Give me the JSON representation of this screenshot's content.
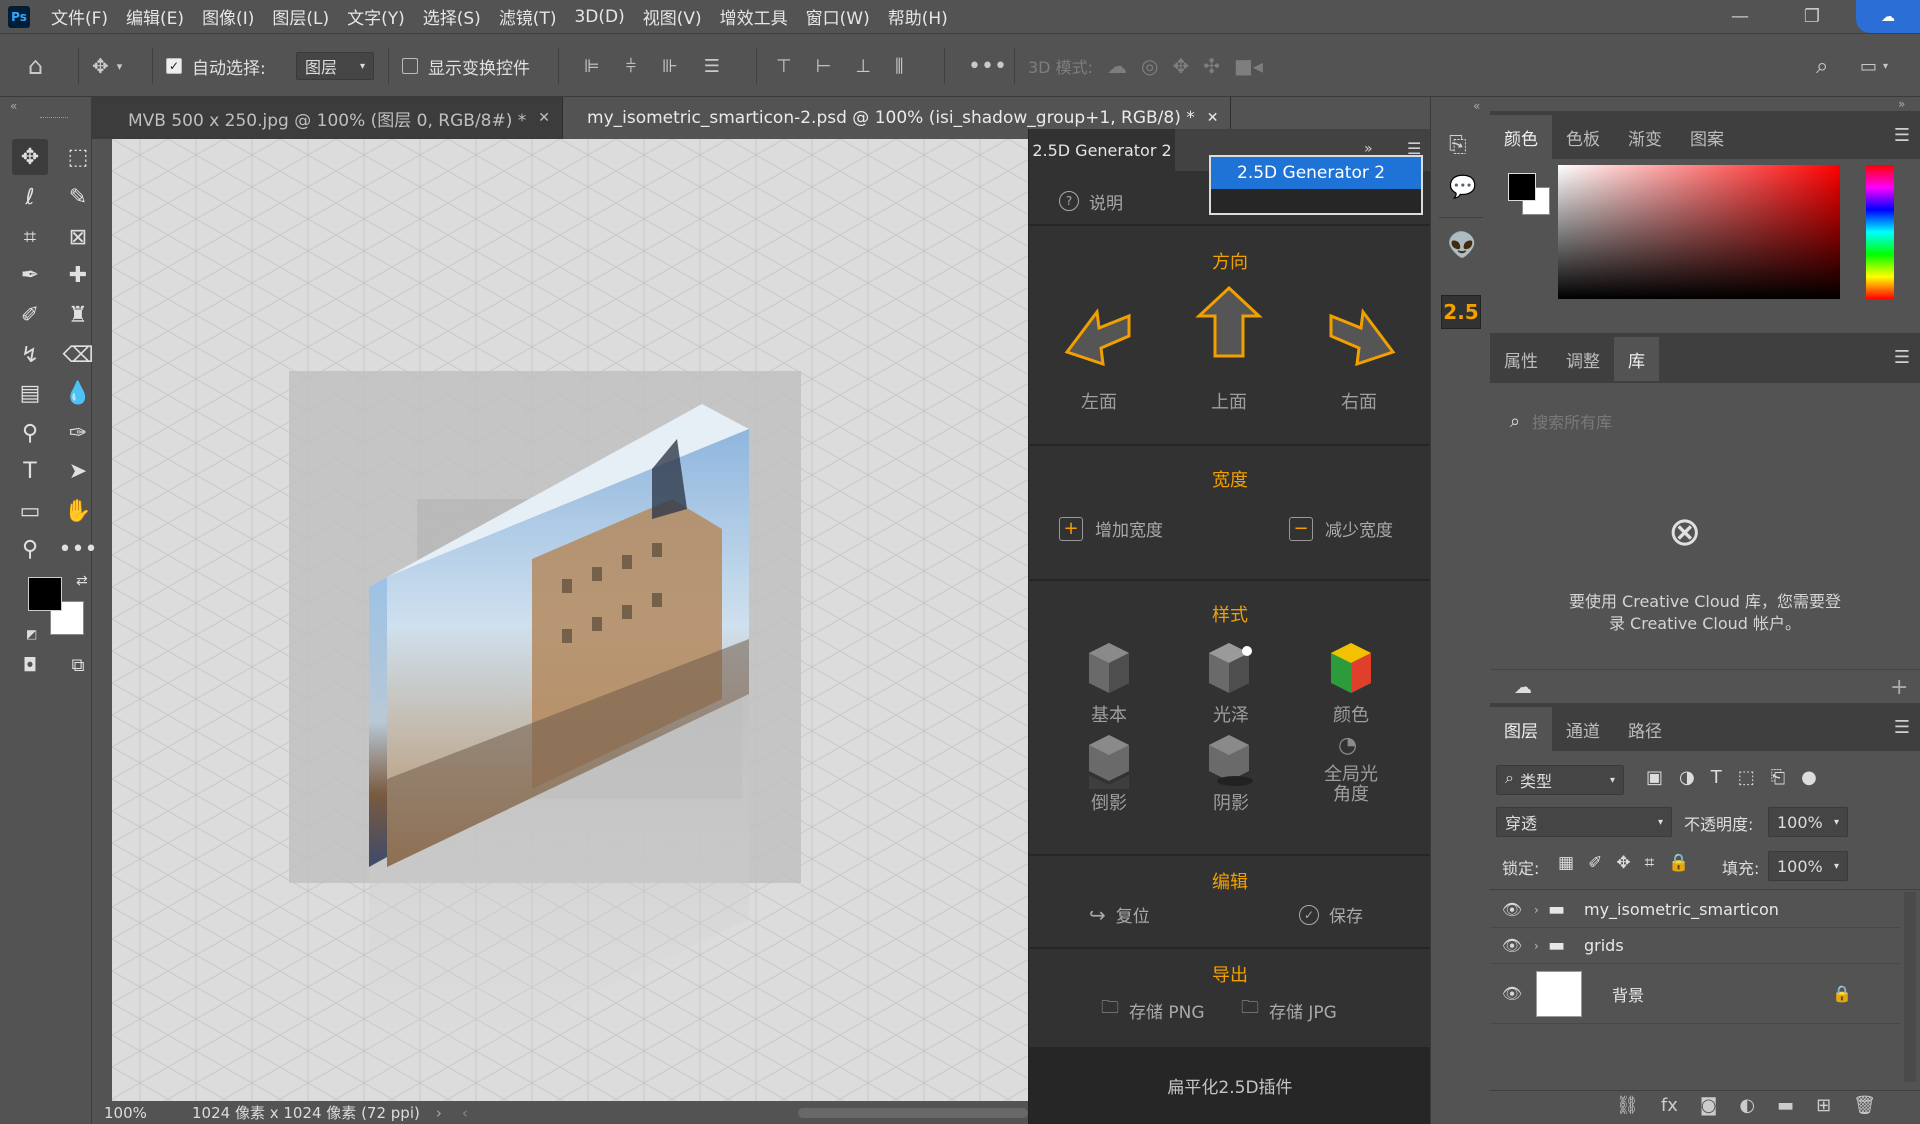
{
  "app": {
    "logo": "Ps"
  },
  "menu": [
    "文件(F)",
    "编辑(E)",
    "图像(I)",
    "图层(L)",
    "文字(Y)",
    "选择(S)",
    "滤镜(T)",
    "3D(D)",
    "视图(V)",
    "增效工具",
    "窗口(W)",
    "帮助(H)"
  ],
  "options": {
    "auto_select_label": "自动选择:",
    "auto_select_value": "图层",
    "show_transform_label": "显示变换控件",
    "mode_3d_label": "3D 模式:"
  },
  "tabs": [
    {
      "label": "MVB 500 x 250.jpg @ 100% (图层 0, RGB/8#) *"
    },
    {
      "label": "my_isometric_smarticon-2.psd @ 100% (isi_shadow_group+1, RGB/8) *"
    }
  ],
  "status": {
    "zoom": "100%",
    "doc_info": "1024 像素 x 1024 像素 (72 ppi)"
  },
  "plugin": {
    "tab_title": "2.5D Generator 2",
    "dropdown_item": "2.5D Generator 2",
    "help_label": "说明",
    "direction": {
      "title": "方向",
      "left": "左面",
      "up": "上面",
      "right": "右面"
    },
    "width": {
      "title": "宽度",
      "add": "增加宽度",
      "reduce": "减少宽度"
    },
    "style": {
      "title": "样式",
      "basic": "基本",
      "gloss": "光泽",
      "color": "颜色",
      "reflection": "倒影",
      "shadow": "阴影",
      "global_light_line1": "全局光",
      "global_light_line2": "角度"
    },
    "edit": {
      "title": "编辑",
      "reset": "复位",
      "save": "保存"
    },
    "export": {
      "title": "导出",
      "png": "存储 PNG",
      "jpg": "存储 JPG"
    },
    "footer": "扁平化2.5D插件"
  },
  "iconstrip": {
    "badge": "2.5"
  },
  "color_panel": {
    "tabs": [
      "颜色",
      "色板",
      "渐变",
      "图案"
    ],
    "foreground": "#000000",
    "background": "#ffffff"
  },
  "library_panel": {
    "tabs": [
      "属性",
      "调整",
      "库"
    ],
    "search_placeholder": "搜索所有库",
    "message_line1": "要使用 Creative Cloud 库，您需要登",
    "message_line2": "录 Creative Cloud 帐户。"
  },
  "layers_panel": {
    "tabs": [
      "图层",
      "通道",
      "路径"
    ],
    "filter_label": "类型",
    "blend_mode": "穿透",
    "opacity_label": "不透明度:",
    "opacity_value": "100%",
    "lock_label": "锁定:",
    "fill_label": "填充:",
    "fill_value": "100%",
    "layers": [
      {
        "name": "my_isometric_smarticon",
        "type": "group"
      },
      {
        "name": "grids",
        "type": "group"
      },
      {
        "name": "背景",
        "type": "background"
      }
    ]
  },
  "colors": {
    "accent": "#f2a000",
    "selection": "#1f73d6",
    "panel_bg": "#535353",
    "plugin_bg": "#323232"
  }
}
